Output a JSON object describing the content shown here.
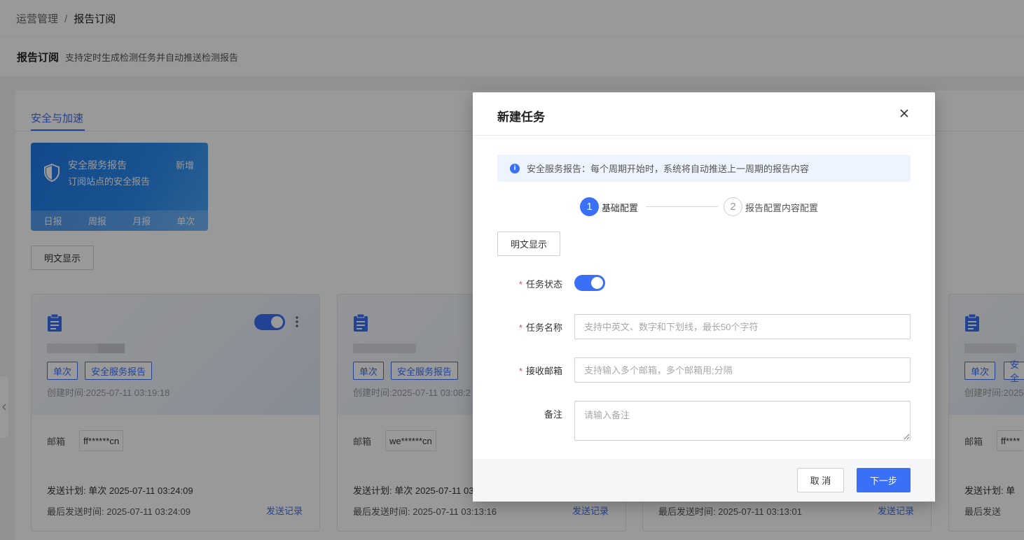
{
  "breadcrumb": {
    "parent": "运营管理",
    "separator": "/",
    "current": "报告订阅"
  },
  "page_header": {
    "title": "报告订阅",
    "description": "支持定时生成检测任务并自动推送检测报告"
  },
  "tabs": [
    {
      "label": "安全与加速",
      "active": true
    }
  ],
  "report_card": {
    "title": "安全服务报告",
    "subtitle": "订阅站点的安全报告",
    "add_label": "新增",
    "periods": [
      "日报",
      "周报",
      "月报",
      "单次"
    ]
  },
  "plaintext_button": "明文显示",
  "task_cards": [
    {
      "tags": [
        "单次",
        "安全服务报告"
      ],
      "created": "创建时间:2025-07-11 03:19:18",
      "email_label": "邮箱",
      "email": "ff******cn",
      "plan": "发送计划: 单次 2025-07-11 03:24:09",
      "last_sent": "最后发送时间: 2025-07-11 03:24:09",
      "record_link": "发送记录"
    },
    {
      "tags": [
        "单次",
        "安全服务报告"
      ],
      "created": "创建时间:2025-07-11 03:08:2",
      "email_label": "邮箱",
      "email": "we******cn",
      "plan": "发送计划: 单次 2025-07-11 03",
      "last_sent": "最后发送时间: 2025-07-11 03:13:16",
      "record_link": "发送记录"
    },
    {
      "last_sent": "最后发送时间: 2025-07-11 03:13:01",
      "record_link": "发送记录"
    },
    {
      "tags": [
        "单次",
        "安全"
      ],
      "created": "创建时间:2025",
      "email_label": "邮箱",
      "email": "ff****",
      "plan": "发送计划: 单",
      "last_sent": "最后发送"
    }
  ],
  "modal": {
    "title": "新建任务",
    "alert": "安全服务报告：每个周期开始时，系统将自动推送上一周期的报告内容",
    "alert_icon": "i",
    "steps": [
      {
        "num": "1",
        "label": "基础配置"
      },
      {
        "num": "2",
        "label": "报告配置内容配置"
      }
    ],
    "plaintext_button": "明文显示",
    "form": {
      "required_mark": "*",
      "status_label": "任务状态",
      "status_on": true,
      "name_label": "任务名称",
      "name_placeholder": "支持中英文、数字和下划线，最长50个字符",
      "email_label": "接收邮箱",
      "email_placeholder": "支持输入多个邮箱，多个邮箱用;分隔",
      "remark_label": "备注",
      "remark_placeholder": "请输入备注"
    },
    "cancel_label": "取 消",
    "next_label": "下一步"
  },
  "colors": {
    "primary": "#3a6ff7",
    "required": "#e34d4d"
  }
}
